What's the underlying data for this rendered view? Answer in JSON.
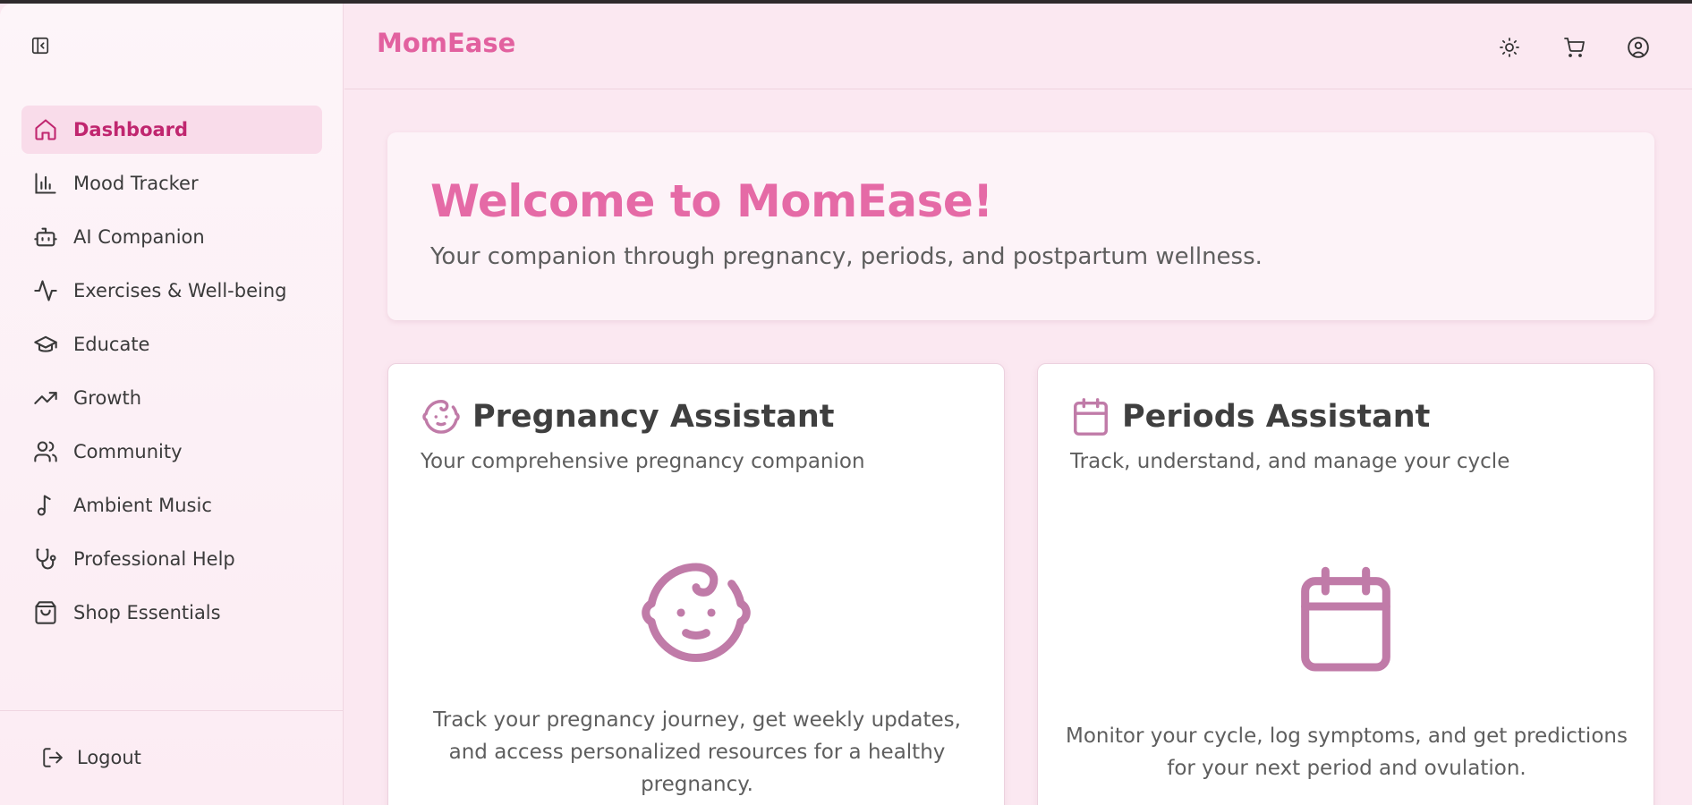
{
  "app": {
    "brand": "MomEase",
    "accent_color": "#e2619f",
    "icon_color": "#c07ba8"
  },
  "sidebar": {
    "collapse_icon": "panel-left-close-icon",
    "items": [
      {
        "label": "Dashboard",
        "icon": "home-icon",
        "active": true
      },
      {
        "label": "Mood Tracker",
        "icon": "bar-chart-icon",
        "active": false
      },
      {
        "label": "AI Companion",
        "icon": "bot-icon",
        "active": false
      },
      {
        "label": "Exercises & Well-being",
        "icon": "activity-icon",
        "active": false
      },
      {
        "label": "Educate",
        "icon": "graduation-cap-icon",
        "active": false
      },
      {
        "label": "Growth",
        "icon": "trending-up-icon",
        "active": false
      },
      {
        "label": "Community",
        "icon": "users-icon",
        "active": false
      },
      {
        "label": "Ambient Music",
        "icon": "music-icon",
        "active": false
      },
      {
        "label": "Professional Help",
        "icon": "stethoscope-icon",
        "active": false
      },
      {
        "label": "Shop Essentials",
        "icon": "shopping-bag-icon",
        "active": false
      }
    ],
    "logout_label": "Logout"
  },
  "header": {
    "icons": [
      "sun-icon",
      "cart-icon",
      "user-circle-icon"
    ]
  },
  "welcome": {
    "title": "Welcome to MomEase!",
    "subtitle": "Your companion through pregnancy, periods, and postpartum wellness."
  },
  "cards": [
    {
      "title": "Pregnancy Assistant",
      "subtitle": "Your comprehensive pregnancy companion",
      "icon": "baby-icon",
      "description": "Track your pregnancy journey, get weekly updates, and access personalized resources for a healthy pregnancy."
    },
    {
      "title": "Periods Assistant",
      "subtitle": "Track, understand, and manage your cycle",
      "icon": "calendar-icon",
      "description": "Monitor your cycle, log symptoms, and get predictions for your next period and ovulation."
    }
  ]
}
